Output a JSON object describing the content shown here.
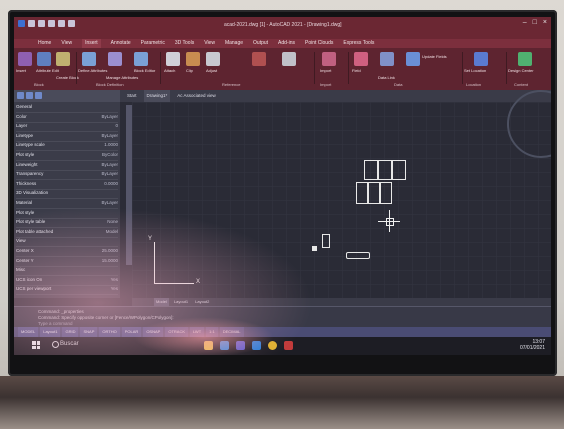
{
  "app": {
    "title": "acad-2021.dwg [1] - AutoCAD 2021 - [Drawing1.dwg]",
    "window_controls": [
      "–",
      "□",
      "×"
    ]
  },
  "ribbon_tabs": [
    "Home",
    "View",
    "Insert",
    "Annotate",
    "Parametric",
    "3D Tools",
    "View",
    "Manage",
    "Output",
    "Add-ins",
    "Point Clouds",
    "Express Tools"
  ],
  "ribbon_active_tab": "Insert",
  "ribbon_groups": {
    "block": {
      "name": "Block",
      "buttons": [
        "Insert",
        "Attribute Edit",
        "Create Block"
      ]
    },
    "block_definition": {
      "name": "Block Definition",
      "buttons": [
        "Define Attributes",
        "Manage Attributes",
        "Block Editor"
      ]
    },
    "reference": {
      "name": "Reference",
      "buttons": [
        "Attach",
        "Clip",
        "Adjust"
      ]
    },
    "import": {
      "name": "Import",
      "buttons": [
        "Import"
      ]
    },
    "data": {
      "name": "Data",
      "buttons": [
        "Field",
        "Data Link",
        "Update Fields"
      ]
    },
    "location": {
      "name": "Location",
      "buttons": [
        "Set Location"
      ]
    },
    "content": {
      "name": "Content",
      "buttons": [
        "Design Center"
      ]
    }
  },
  "document_tabs": [
    "Start",
    "Drawing1*",
    "Ac Associated view"
  ],
  "properties_panel": {
    "rows": [
      {
        "label": "General",
        "value": ""
      },
      {
        "label": "Color",
        "value": "ByLayer"
      },
      {
        "label": "Layer",
        "value": "0"
      },
      {
        "label": "Linetype",
        "value": "ByLayer"
      },
      {
        "label": "Linetype scale",
        "value": "1.0000"
      },
      {
        "label": "Plot style",
        "value": "ByColor"
      },
      {
        "label": "Lineweight",
        "value": "ByLayer"
      },
      {
        "label": "Transparency",
        "value": "ByLayer"
      },
      {
        "label": "Thickness",
        "value": "0.0000"
      },
      {
        "label": "3D Visualization",
        "value": ""
      },
      {
        "label": "Material",
        "value": "ByLayer"
      },
      {
        "label": "Plot style",
        "value": ""
      },
      {
        "label": "Plot style table",
        "value": "None"
      },
      {
        "label": "Plot table attached",
        "value": "Model"
      },
      {
        "label": "View",
        "value": ""
      },
      {
        "label": "Center X",
        "value": "25.0000"
      },
      {
        "label": "Center Y",
        "value": "15.0000"
      },
      {
        "label": "Misc",
        "value": ""
      },
      {
        "label": "UCS icon On",
        "value": "Yes"
      },
      {
        "label": "UCS per viewport",
        "value": "Yes"
      }
    ]
  },
  "canvas": {
    "axis_y_label": "Y",
    "axis_x_label": "X",
    "background_color": "#2a2b36"
  },
  "layout_tabs": [
    "Model",
    "Layout1",
    "Layout2"
  ],
  "command_line": {
    "lines": [
      "Command: _properties",
      "Command: Specify opposite corner or [Fence/WPolygon/CPolygon]:"
    ],
    "prompt": "Type a command"
  },
  "status_bar": {
    "items": [
      "MODEL",
      "Layout1",
      "GRID",
      "SNAP",
      "ORTHO",
      "POLAR",
      "OSNAP",
      "OTRACK",
      "LWT",
      "1:1",
      "DECIMAL"
    ]
  },
  "taskbar": {
    "search_text": "Buscar",
    "time": "13:07",
    "date": "07/01/2021",
    "apps": [
      "file-explorer-icon",
      "edge-icon",
      "store-icon",
      "mail-icon",
      "chrome-icon",
      "autocad-icon"
    ]
  },
  "colors": {
    "title_bar": "#6b2733",
    "ribbon": "#5e2430",
    "canvas": "#2a2b36",
    "taskbar": "#1d1d24"
  }
}
